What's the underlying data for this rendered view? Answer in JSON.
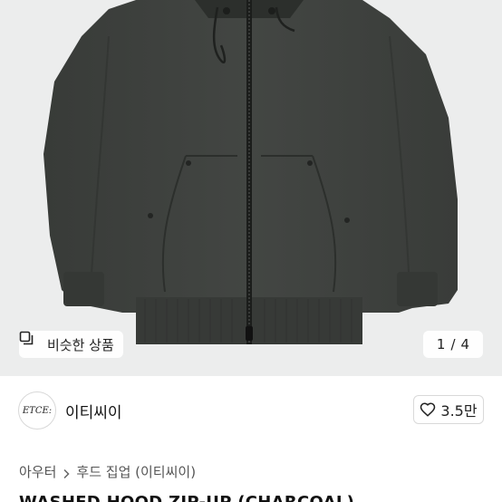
{
  "product": {
    "image_alt": "charcoal washed hooded zip-up",
    "similar_button_label": "비슷한 상품",
    "image_counter": {
      "current": "1",
      "separator": "/",
      "total": "4"
    }
  },
  "shop": {
    "logo_text": "ETCE:",
    "name": "이티씨이",
    "like_count": "3.5만"
  },
  "breadcrumb": {
    "category": "아우터",
    "subcategory": "후드 집업 (이티씨이)"
  },
  "title": "WASHED HOOD ZIP-UP (CHARCOAL)",
  "colors": {
    "garment": "#3f423f",
    "background": "#eceded"
  },
  "icons": [
    "similar-items-icon",
    "heart-icon",
    "chevron-right-icon"
  ]
}
